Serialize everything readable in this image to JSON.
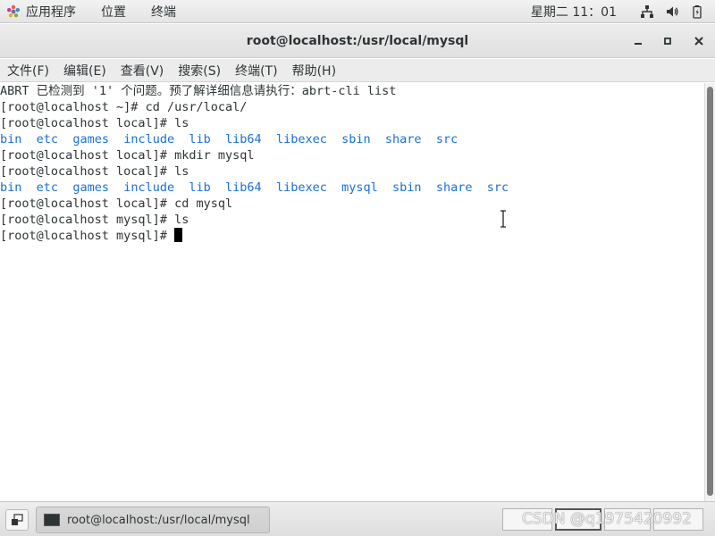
{
  "top_panel": {
    "applications_label": "应用程序",
    "places_label": "位置",
    "terminal_label": "终端",
    "clock": "星期二 11：01"
  },
  "window": {
    "title": "root@localhost:/usr/local/mysql"
  },
  "menubar": {
    "items": [
      "文件(F)",
      "编辑(E)",
      "查看(V)",
      "搜索(S)",
      "终端(T)",
      "帮助(H)"
    ]
  },
  "terminal": {
    "abrt_notice": "ABRT 已检测到 '1' 个问题。预了解详细信息请执行：abrt-cli list",
    "lines": [
      {
        "prompt": "[root@localhost ~]# ",
        "command": "cd /usr/local/"
      },
      {
        "prompt": "[root@localhost local]# ",
        "command": "ls"
      },
      {
        "listing": [
          "bin",
          "etc",
          "games",
          "include",
          "lib",
          "lib64",
          "libexec",
          "sbin",
          "share",
          "src"
        ]
      },
      {
        "prompt": "[root@localhost local]# ",
        "command": "mkdir mysql"
      },
      {
        "prompt": "[root@localhost local]# ",
        "command": "ls"
      },
      {
        "listing": [
          "bin",
          "etc",
          "games",
          "include",
          "lib",
          "lib64",
          "libexec",
          "mysql",
          "sbin",
          "share",
          "src"
        ]
      },
      {
        "prompt": "[root@localhost local]# ",
        "command": "cd mysql"
      },
      {
        "prompt": "[root@localhost mysql]# ",
        "command": "ls"
      },
      {
        "prompt": "[root@localhost mysql]# ",
        "command": ""
      }
    ]
  },
  "taskbar": {
    "task_label": "root@localhost:/usr/local/mysql",
    "watermark": "CSDN @q1975420992"
  },
  "colors": {
    "directory_blue": "#1a6fd8",
    "terminal_background": "#ffffff",
    "panel_background": "#e9e9e9"
  }
}
